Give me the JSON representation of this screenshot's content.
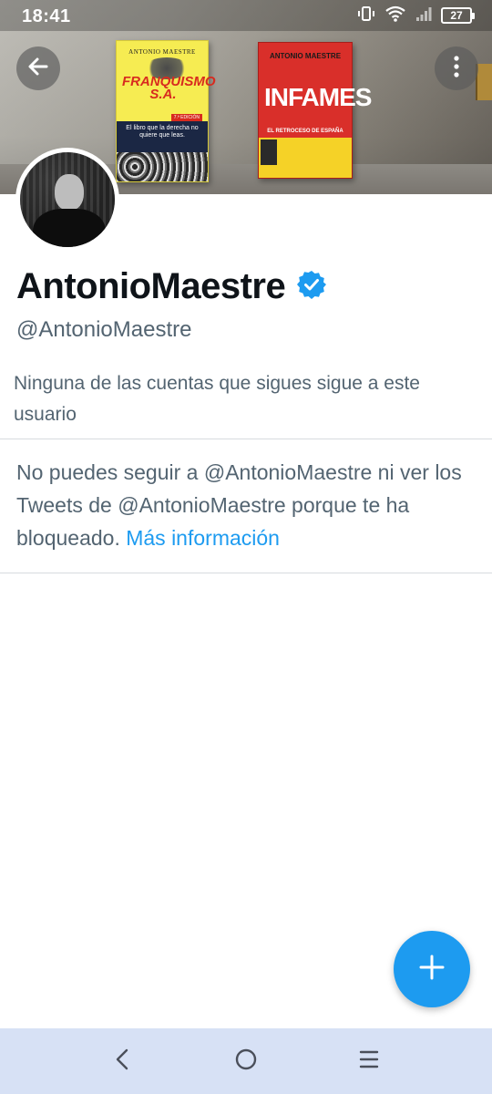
{
  "status_bar": {
    "time": "18:41",
    "battery": "27",
    "icons": [
      "vibrate-icon",
      "wifi-icon",
      "signal-icon",
      "battery-icon"
    ]
  },
  "header": {
    "back_icon": "arrow-left-icon",
    "more_icon": "more-vertical-icon"
  },
  "banner": {
    "book_1": {
      "author": "ANTONIO MAESTRE",
      "title_line1": "FRANQUISMO",
      "title_line2": "S.A.",
      "edition": "7.ª EDICIÓN",
      "tagline": "El libro que la derecha no quiere que leas."
    },
    "book_2": {
      "author": "ANTONIO MAESTRE",
      "title": "INFAMES",
      "subtitle": "EL RETROCESO DE ESPAÑA"
    }
  },
  "profile": {
    "display_name": "AntonioMaestre",
    "verified_icon": "verified-badge-icon",
    "handle": "@AntonioMaestre",
    "followers_note": "Ninguna de las cuentas que sigues sigue a este usuario"
  },
  "blocked": {
    "message": "No puedes seguir a @AntonioMaestre ni ver los Tweets de @AntonioMaestre porque te ha bloqueado.",
    "link_text": "Más información"
  },
  "fab": {
    "icon": "plus-icon"
  },
  "nav_bar": {
    "back_icon": "nav-back-icon",
    "home_icon": "nav-home-icon",
    "menu_icon": "nav-recents-icon"
  },
  "colors": {
    "accent": "#1d9bf0",
    "secondary_text": "#536471",
    "primary_text": "#0f1419",
    "nav_bar_bg": "#d7e1f5"
  }
}
